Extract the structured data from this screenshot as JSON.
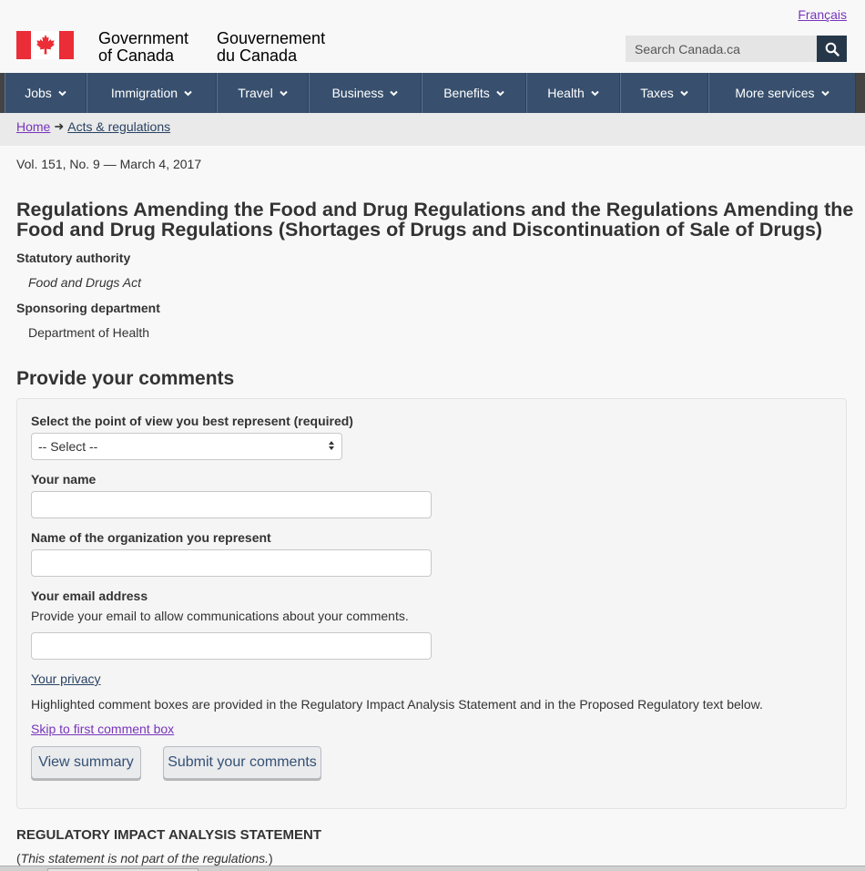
{
  "header": {
    "language_link": "Français",
    "brand_en_line1": "Government",
    "brand_en_line2": "of Canada",
    "brand_fr_line1": "Gouvernement",
    "brand_fr_line2": "du Canada",
    "flag_icon": "canada-flag-icon",
    "search_placeholder": "Search Canada.ca",
    "search_icon": "search-icon"
  },
  "menu": {
    "items": [
      {
        "label": "Jobs"
      },
      {
        "label": "Immigration"
      },
      {
        "label": "Travel"
      },
      {
        "label": "Business"
      },
      {
        "label": "Benefits"
      },
      {
        "label": "Health"
      },
      {
        "label": "Taxes"
      },
      {
        "label": "More services"
      }
    ]
  },
  "breadcrumb": {
    "home": "Home",
    "current": "Acts & regulations"
  },
  "document": {
    "volume": "Vol. 151, No. 9 — March 4, 2017",
    "title": "Regulations Amending the Food and Drug Regulations and the Regulations Amending the Food and Drug Regulations (Shortages of Drugs and Discontinuation of Sale of Drugs)",
    "statutory_authority_label": "Statutory authority",
    "statutory_authority_value": "Food and Drugs Act",
    "sponsoring_department_label": "Sponsoring department",
    "sponsoring_department_value": "Department of Health"
  },
  "comment_form": {
    "heading": "Provide your comments",
    "point_of_view_label": "Select the point of view you best represent (required)",
    "point_of_view_selected": "-- Select --",
    "name_label": "Your name",
    "name_value": "",
    "organization_label": "Name of the organization you represent",
    "organization_value": "",
    "email_label": "Your email address",
    "email_help": "Provide your email to allow communications about your comments.",
    "email_value": "",
    "privacy_link": "Your privacy",
    "highlight_note": "Highlighted comment boxes are provided in the Regulatory Impact Analysis Statement and in the Proposed Regulatory text below.",
    "skip_link": "Skip to first comment box",
    "view_summary_button": "View summary",
    "submit_button": "Submit your comments"
  },
  "ria": {
    "heading": "REGULATORY IMPACT ANALYSIS STATEMENT",
    "note_open": "(",
    "note_italic": "This statement is not part of the regulations.",
    "note_close": ")"
  },
  "colors": {
    "menu_bg": "#38506e",
    "link_visited": "#7834bc",
    "flag_red": "#eb2d37",
    "search_button": "#26374a"
  }
}
